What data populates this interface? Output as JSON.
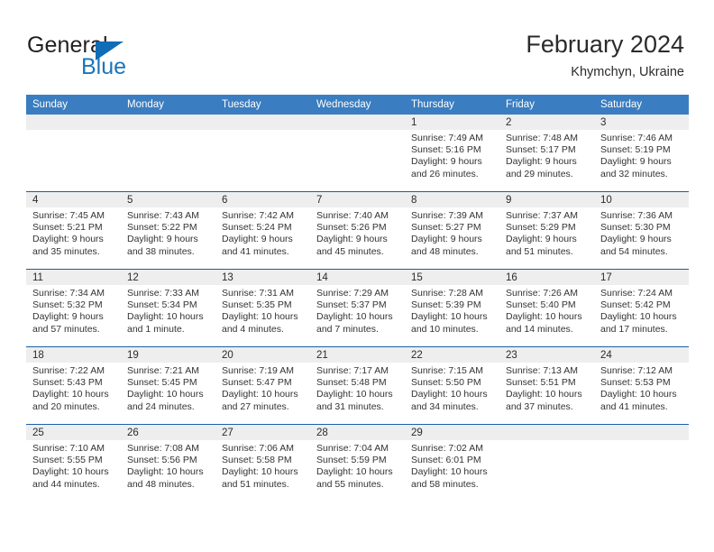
{
  "brand": {
    "name_part1": "General",
    "name_part2": "Blue",
    "triangle_color": "#0f6cb5",
    "blue_text_color": "#1b75bb"
  },
  "header": {
    "title": "February 2024",
    "subtitle": "Khymchyn, Ukraine",
    "header_bg_color": "#3a7dc0",
    "header_text_color": "#ffffff",
    "grid_line_color": "#1a5fa3",
    "daynum_band_color": "#eeeeee"
  },
  "weekday_headers": [
    "Sunday",
    "Monday",
    "Tuesday",
    "Wednesday",
    "Thursday",
    "Friday",
    "Saturday"
  ],
  "weeks": [
    [
      {
        "day": "",
        "sunrise": "",
        "sunset": "",
        "daylight1": "",
        "daylight2": ""
      },
      {
        "day": "",
        "sunrise": "",
        "sunset": "",
        "daylight1": "",
        "daylight2": ""
      },
      {
        "day": "",
        "sunrise": "",
        "sunset": "",
        "daylight1": "",
        "daylight2": ""
      },
      {
        "day": "",
        "sunrise": "",
        "sunset": "",
        "daylight1": "",
        "daylight2": ""
      },
      {
        "day": "1",
        "sunrise": "Sunrise: 7:49 AM",
        "sunset": "Sunset: 5:16 PM",
        "daylight1": "Daylight: 9 hours",
        "daylight2": "and 26 minutes."
      },
      {
        "day": "2",
        "sunrise": "Sunrise: 7:48 AM",
        "sunset": "Sunset: 5:17 PM",
        "daylight1": "Daylight: 9 hours",
        "daylight2": "and 29 minutes."
      },
      {
        "day": "3",
        "sunrise": "Sunrise: 7:46 AM",
        "sunset": "Sunset: 5:19 PM",
        "daylight1": "Daylight: 9 hours",
        "daylight2": "and 32 minutes."
      }
    ],
    [
      {
        "day": "4",
        "sunrise": "Sunrise: 7:45 AM",
        "sunset": "Sunset: 5:21 PM",
        "daylight1": "Daylight: 9 hours",
        "daylight2": "and 35 minutes."
      },
      {
        "day": "5",
        "sunrise": "Sunrise: 7:43 AM",
        "sunset": "Sunset: 5:22 PM",
        "daylight1": "Daylight: 9 hours",
        "daylight2": "and 38 minutes."
      },
      {
        "day": "6",
        "sunrise": "Sunrise: 7:42 AM",
        "sunset": "Sunset: 5:24 PM",
        "daylight1": "Daylight: 9 hours",
        "daylight2": "and 41 minutes."
      },
      {
        "day": "7",
        "sunrise": "Sunrise: 7:40 AM",
        "sunset": "Sunset: 5:26 PM",
        "daylight1": "Daylight: 9 hours",
        "daylight2": "and 45 minutes."
      },
      {
        "day": "8",
        "sunrise": "Sunrise: 7:39 AM",
        "sunset": "Sunset: 5:27 PM",
        "daylight1": "Daylight: 9 hours",
        "daylight2": "and 48 minutes."
      },
      {
        "day": "9",
        "sunrise": "Sunrise: 7:37 AM",
        "sunset": "Sunset: 5:29 PM",
        "daylight1": "Daylight: 9 hours",
        "daylight2": "and 51 minutes."
      },
      {
        "day": "10",
        "sunrise": "Sunrise: 7:36 AM",
        "sunset": "Sunset: 5:30 PM",
        "daylight1": "Daylight: 9 hours",
        "daylight2": "and 54 minutes."
      }
    ],
    [
      {
        "day": "11",
        "sunrise": "Sunrise: 7:34 AM",
        "sunset": "Sunset: 5:32 PM",
        "daylight1": "Daylight: 9 hours",
        "daylight2": "and 57 minutes."
      },
      {
        "day": "12",
        "sunrise": "Sunrise: 7:33 AM",
        "sunset": "Sunset: 5:34 PM",
        "daylight1": "Daylight: 10 hours",
        "daylight2": "and 1 minute."
      },
      {
        "day": "13",
        "sunrise": "Sunrise: 7:31 AM",
        "sunset": "Sunset: 5:35 PM",
        "daylight1": "Daylight: 10 hours",
        "daylight2": "and 4 minutes."
      },
      {
        "day": "14",
        "sunrise": "Sunrise: 7:29 AM",
        "sunset": "Sunset: 5:37 PM",
        "daylight1": "Daylight: 10 hours",
        "daylight2": "and 7 minutes."
      },
      {
        "day": "15",
        "sunrise": "Sunrise: 7:28 AM",
        "sunset": "Sunset: 5:39 PM",
        "daylight1": "Daylight: 10 hours",
        "daylight2": "and 10 minutes."
      },
      {
        "day": "16",
        "sunrise": "Sunrise: 7:26 AM",
        "sunset": "Sunset: 5:40 PM",
        "daylight1": "Daylight: 10 hours",
        "daylight2": "and 14 minutes."
      },
      {
        "day": "17",
        "sunrise": "Sunrise: 7:24 AM",
        "sunset": "Sunset: 5:42 PM",
        "daylight1": "Daylight: 10 hours",
        "daylight2": "and 17 minutes."
      }
    ],
    [
      {
        "day": "18",
        "sunrise": "Sunrise: 7:22 AM",
        "sunset": "Sunset: 5:43 PM",
        "daylight1": "Daylight: 10 hours",
        "daylight2": "and 20 minutes."
      },
      {
        "day": "19",
        "sunrise": "Sunrise: 7:21 AM",
        "sunset": "Sunset: 5:45 PM",
        "daylight1": "Daylight: 10 hours",
        "daylight2": "and 24 minutes."
      },
      {
        "day": "20",
        "sunrise": "Sunrise: 7:19 AM",
        "sunset": "Sunset: 5:47 PM",
        "daylight1": "Daylight: 10 hours",
        "daylight2": "and 27 minutes."
      },
      {
        "day": "21",
        "sunrise": "Sunrise: 7:17 AM",
        "sunset": "Sunset: 5:48 PM",
        "daylight1": "Daylight: 10 hours",
        "daylight2": "and 31 minutes."
      },
      {
        "day": "22",
        "sunrise": "Sunrise: 7:15 AM",
        "sunset": "Sunset: 5:50 PM",
        "daylight1": "Daylight: 10 hours",
        "daylight2": "and 34 minutes."
      },
      {
        "day": "23",
        "sunrise": "Sunrise: 7:13 AM",
        "sunset": "Sunset: 5:51 PM",
        "daylight1": "Daylight: 10 hours",
        "daylight2": "and 37 minutes."
      },
      {
        "day": "24",
        "sunrise": "Sunrise: 7:12 AM",
        "sunset": "Sunset: 5:53 PM",
        "daylight1": "Daylight: 10 hours",
        "daylight2": "and 41 minutes."
      }
    ],
    [
      {
        "day": "25",
        "sunrise": "Sunrise: 7:10 AM",
        "sunset": "Sunset: 5:55 PM",
        "daylight1": "Daylight: 10 hours",
        "daylight2": "and 44 minutes."
      },
      {
        "day": "26",
        "sunrise": "Sunrise: 7:08 AM",
        "sunset": "Sunset: 5:56 PM",
        "daylight1": "Daylight: 10 hours",
        "daylight2": "and 48 minutes."
      },
      {
        "day": "27",
        "sunrise": "Sunrise: 7:06 AM",
        "sunset": "Sunset: 5:58 PM",
        "daylight1": "Daylight: 10 hours",
        "daylight2": "and 51 minutes."
      },
      {
        "day": "28",
        "sunrise": "Sunrise: 7:04 AM",
        "sunset": "Sunset: 5:59 PM",
        "daylight1": "Daylight: 10 hours",
        "daylight2": "and 55 minutes."
      },
      {
        "day": "29",
        "sunrise": "Sunrise: 7:02 AM",
        "sunset": "Sunset: 6:01 PM",
        "daylight1": "Daylight: 10 hours",
        "daylight2": "and 58 minutes."
      },
      {
        "day": "",
        "sunrise": "",
        "sunset": "",
        "daylight1": "",
        "daylight2": ""
      },
      {
        "day": "",
        "sunrise": "",
        "sunset": "",
        "daylight1": "",
        "daylight2": ""
      }
    ]
  ]
}
